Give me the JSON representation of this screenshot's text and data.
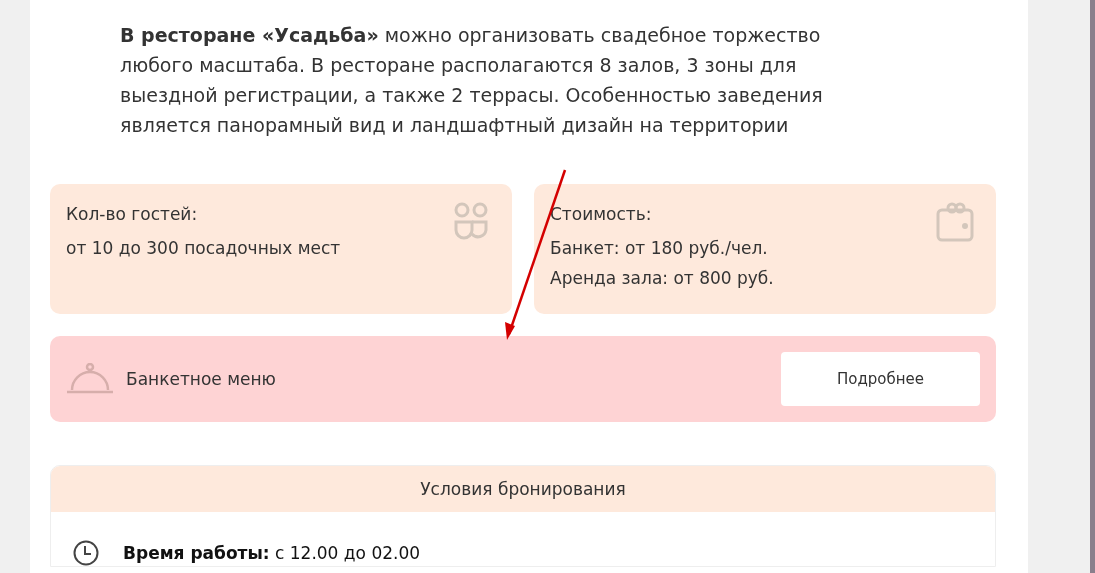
{
  "intro": "**В ресторане «Усадьба»** можно организовать свадебное торжество любого масштаба. В ресторане располагаются 8 залов, 3 зоны для выездной регистрации, а также 2 террасы. Особенностью заведения является панорамный вид и ландшафтный дизайн на территории",
  "info_cards": [
    {
      "kind": "guests",
      "title": "Кол-во гостей:",
      "lines": [
        "от 10 до 300 посадочных мест"
      ]
    },
    {
      "kind": "price",
      "title": "Стоимость:",
      "lines": [
        "Банкет: от 180 руб./чел.",
        "Аренда зала: от 800 руб."
      ]
    }
  ],
  "menu_banner": {
    "label": "Банкетное меню",
    "button": "Подробнее"
  },
  "booking": {
    "title": "Условия бронирования",
    "rows": [
      {
        "kind": "hours",
        "text": "**Время работы:** с 12.00 до 02.00"
      }
    ]
  }
}
